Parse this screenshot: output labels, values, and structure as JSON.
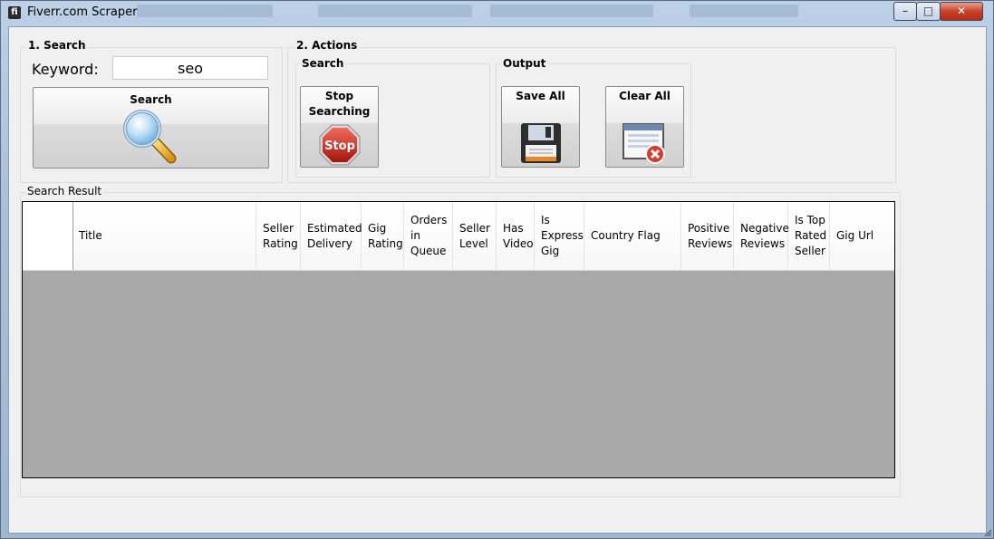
{
  "window": {
    "title": "Fiverr.com Scraper",
    "app_icon_glyph": "fi",
    "controls": {
      "minimize": "–",
      "maximize": "□",
      "close": "✕"
    }
  },
  "search_group": {
    "label": "1. Search",
    "keyword_label": "Keyword:",
    "keyword_value": "seo",
    "search_button": "Search",
    "search_icon": "magnifier-icon"
  },
  "actions_group": {
    "label": "2. Actions",
    "search_sub": {
      "label": "Search",
      "stop_button": "Stop\nSearching",
      "stop_icon": "stop-sign-icon",
      "stop_sign_text": "Stop"
    },
    "output_sub": {
      "label": "Output",
      "save_all": "Save All",
      "save_icon": "floppy-disk-icon",
      "clear_all": "Clear All",
      "clear_icon": "clear-window-icon"
    }
  },
  "result_group": {
    "label": "Search Result",
    "columns": [
      "",
      "Title",
      "Seller Rating",
      "Estimated Delivery",
      "Gig Rating",
      "Orders in Queue",
      "Seller Level",
      "Has Video",
      "Is Express Gig",
      "Country Flag",
      "Positive Reviews",
      "Negative Reviews",
      "Is Top Rated Seller",
      "Gig Url"
    ],
    "rows": []
  },
  "colors": {
    "grid_background": "#a9a9a9",
    "close_button": "#c7422b",
    "window_frame": "#a9c0da"
  }
}
